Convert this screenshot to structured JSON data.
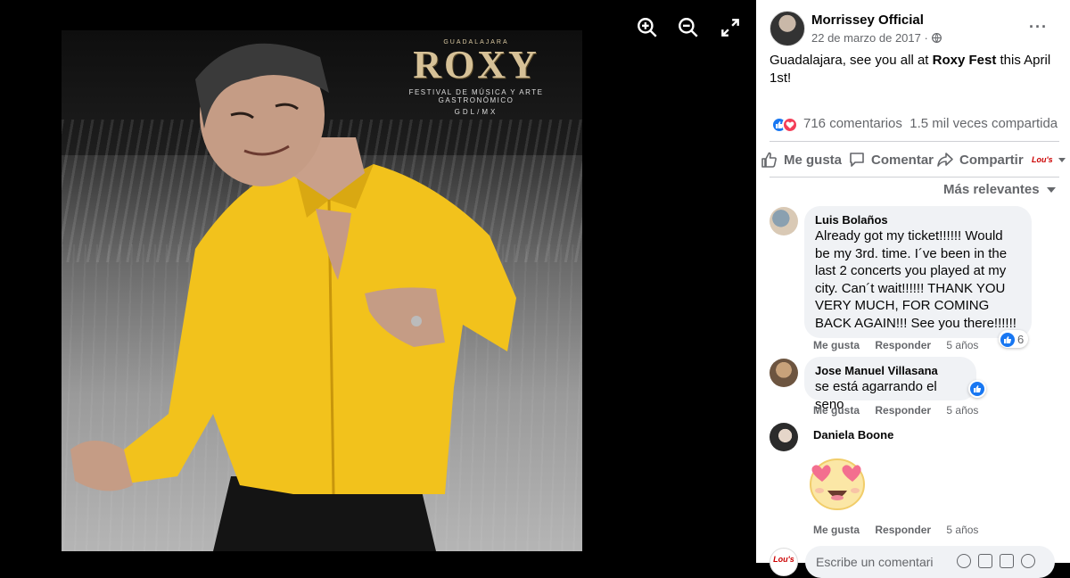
{
  "viewer": {
    "poster": {
      "city": "GUADALAJARA",
      "title": "ROXY",
      "festival": "FESTIVAL DE MÚSICA Y ARTE GASTRONÓMICO",
      "location": "GDL/MX"
    },
    "controls": [
      "zoom-in-icon",
      "zoom-out-icon",
      "fullscreen-icon"
    ]
  },
  "post": {
    "author": "Morrissey Official",
    "date": "22 de marzo de 2017 ·",
    "text_before": "Guadalajara, see you all at ",
    "text_bold": "Roxy Fest",
    "text_after": " this April 1st!",
    "comments_count": "716 comentarios",
    "shares_count": "1.5 mil veces compartida",
    "actions": {
      "like": "Me gusta",
      "comment": "Comentar",
      "share": "Compartir",
      "page_badge": "Lou's"
    },
    "sort_label": "Más relevantes"
  },
  "comments": [
    {
      "name": "Luis Bolaños",
      "text": "Already got my ticket!!!!!! Would be my 3rd. time. I´ve been in the last 2 concerts you played at my city. Can´t wait!!!!!! THANK YOU VERY MUCH, FOR COMING BACK AGAIN!!! See you there!!!!!!",
      "like": "Me gusta",
      "reply": "Responder",
      "time": "5 años",
      "reactions": "6"
    },
    {
      "name": "Jose Manuel Villasana",
      "text": "se está agarrando el seno",
      "like": "Me gusta",
      "reply": "Responder",
      "time": "5 años"
    },
    {
      "name": "Daniela Boone",
      "like": "Me gusta",
      "reply": "Responder",
      "time": "5 años"
    }
  ],
  "composer": {
    "placeholder": "Escribe un comentari",
    "avatar_text": "Lou's"
  },
  "colors": {
    "accent": "#1877f2",
    "love": "#f33e58",
    "text_secondary": "#65676b",
    "bubble": "#f0f2f5"
  }
}
